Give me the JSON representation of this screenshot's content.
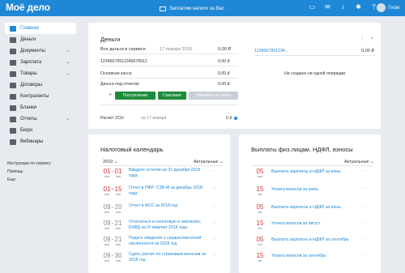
{
  "header": {
    "logo": "Моё дело",
    "promo": "Заплатим налоги за Вас",
    "user_name": "Гном",
    "icons": [
      "chat-icon",
      "mail-icon",
      "bell-icon",
      "gear-icon",
      "help-icon"
    ]
  },
  "sidebar": {
    "items": [
      {
        "label": "Главная",
        "icon": "home-icon",
        "active": true,
        "chevron": false
      },
      {
        "label": "Деньги",
        "icon": "money-icon",
        "active": false,
        "chevron": false
      },
      {
        "label": "Документы",
        "icon": "documents-icon",
        "active": false,
        "chevron": true
      },
      {
        "label": "Зарплата",
        "icon": "salary-icon",
        "active": false,
        "chevron": true
      },
      {
        "label": "Товары",
        "icon": "goods-icon",
        "active": false,
        "chevron": true
      },
      {
        "label": "Договоры",
        "icon": "contracts-icon",
        "active": false,
        "chevron": false
      },
      {
        "label": "Контрагенты",
        "icon": "contractors-icon",
        "active": false,
        "chevron": false
      },
      {
        "label": "Бланки",
        "icon": "forms-icon",
        "active": false,
        "chevron": false
      },
      {
        "label": "Отчеты",
        "icon": "reports-icon",
        "active": false,
        "chevron": true
      },
      {
        "label": "Бюро",
        "icon": "bureau-icon",
        "active": false,
        "chevron": false
      },
      {
        "label": "Вебинары",
        "icon": "webinars-icon",
        "active": false,
        "chevron": false
      }
    ],
    "links": [
      "Инструкции по сервису",
      "Помощь",
      "Еще"
    ]
  },
  "money": {
    "title": "Деньги",
    "total_label": "Все деньги в сервисе",
    "total_date": "17 января 2019",
    "total_value": "0,00 ₽",
    "account_left": "12345678912345678912",
    "account_left_value": "0,00 ₽",
    "main_cash_label": "Основная касса",
    "main_cash_value": "0,00 ₽",
    "accountable_label": "Деньги под отчетом",
    "accountable_value": "0,00 ₽",
    "btn_income": "Поступление",
    "btn_writeoff": "Списание",
    "btn_update": "Обновить из банка",
    "usn_label": "Расчет УСН",
    "usn_date": "на 17 января",
    "usn_value": "0 ₽",
    "account_right": "12345678912З4...",
    "account_right_value": "0,00 ₽",
    "no_ops": "Не создано ни одной операции"
  },
  "tax": {
    "title": "Налоговый календарь",
    "year": "2019",
    "filter": "Актуальные",
    "items": [
      {
        "d1": "01",
        "m1": "янв",
        "d2": "01",
        "m2": "янв",
        "color": "red",
        "text": "Введите остатки на 31 декабря 2018 года"
      },
      {
        "d1": "01",
        "m1": "янв",
        "d2": "15",
        "m2": "янв",
        "color": "red",
        "text": "Отчет в ПФР: СЗВ-М за декабрь 2018 года"
      },
      {
        "d1": "09",
        "m1": "янв",
        "d2": "20",
        "m2": "янв",
        "color": "gray",
        "text": "Отчет в ФСС за 2018 год"
      },
      {
        "d1": "09",
        "m1": "янв",
        "d2": "21",
        "m2": "янв",
        "color": "gray",
        "text": "Отчитаться в налоговую и заплатить ЕНВД за IV квартал 2018 года"
      },
      {
        "d1": "09",
        "m1": "янв",
        "d2": "21",
        "m2": "янв",
        "color": "gray",
        "text": "Подать сведения о среднесписочной численности за 2018 год"
      },
      {
        "d1": "09",
        "m1": "янв",
        "d2": "30",
        "m2": "янв",
        "color": "gray",
        "text": "Сдать расчет по страховым взносам за 2018 год"
      }
    ]
  },
  "payouts": {
    "title": "Выплаты физ.лицам, НДФЛ, взносы",
    "filter": "Актуальные",
    "items": [
      {
        "d": "05",
        "m": "июл",
        "text": "Выплата зарплаты и НДФЛ за июнь"
      },
      {
        "d": "15",
        "m": "авг",
        "text": "Уплата взносов за июль"
      },
      {
        "d": "05",
        "m": "авг",
        "text": "Выплата зарплаты и НДФЛ за июль"
      },
      {
        "d": "15",
        "m": "сен",
        "text": "Уплата взносов за август"
      },
      {
        "d": "05",
        "m": "сен",
        "text": "Выплата зарплаты и НДФЛ за сентябрь"
      },
      {
        "d": "15",
        "m": "окт",
        "text": "Уплата взносов за сентябрь"
      }
    ]
  }
}
